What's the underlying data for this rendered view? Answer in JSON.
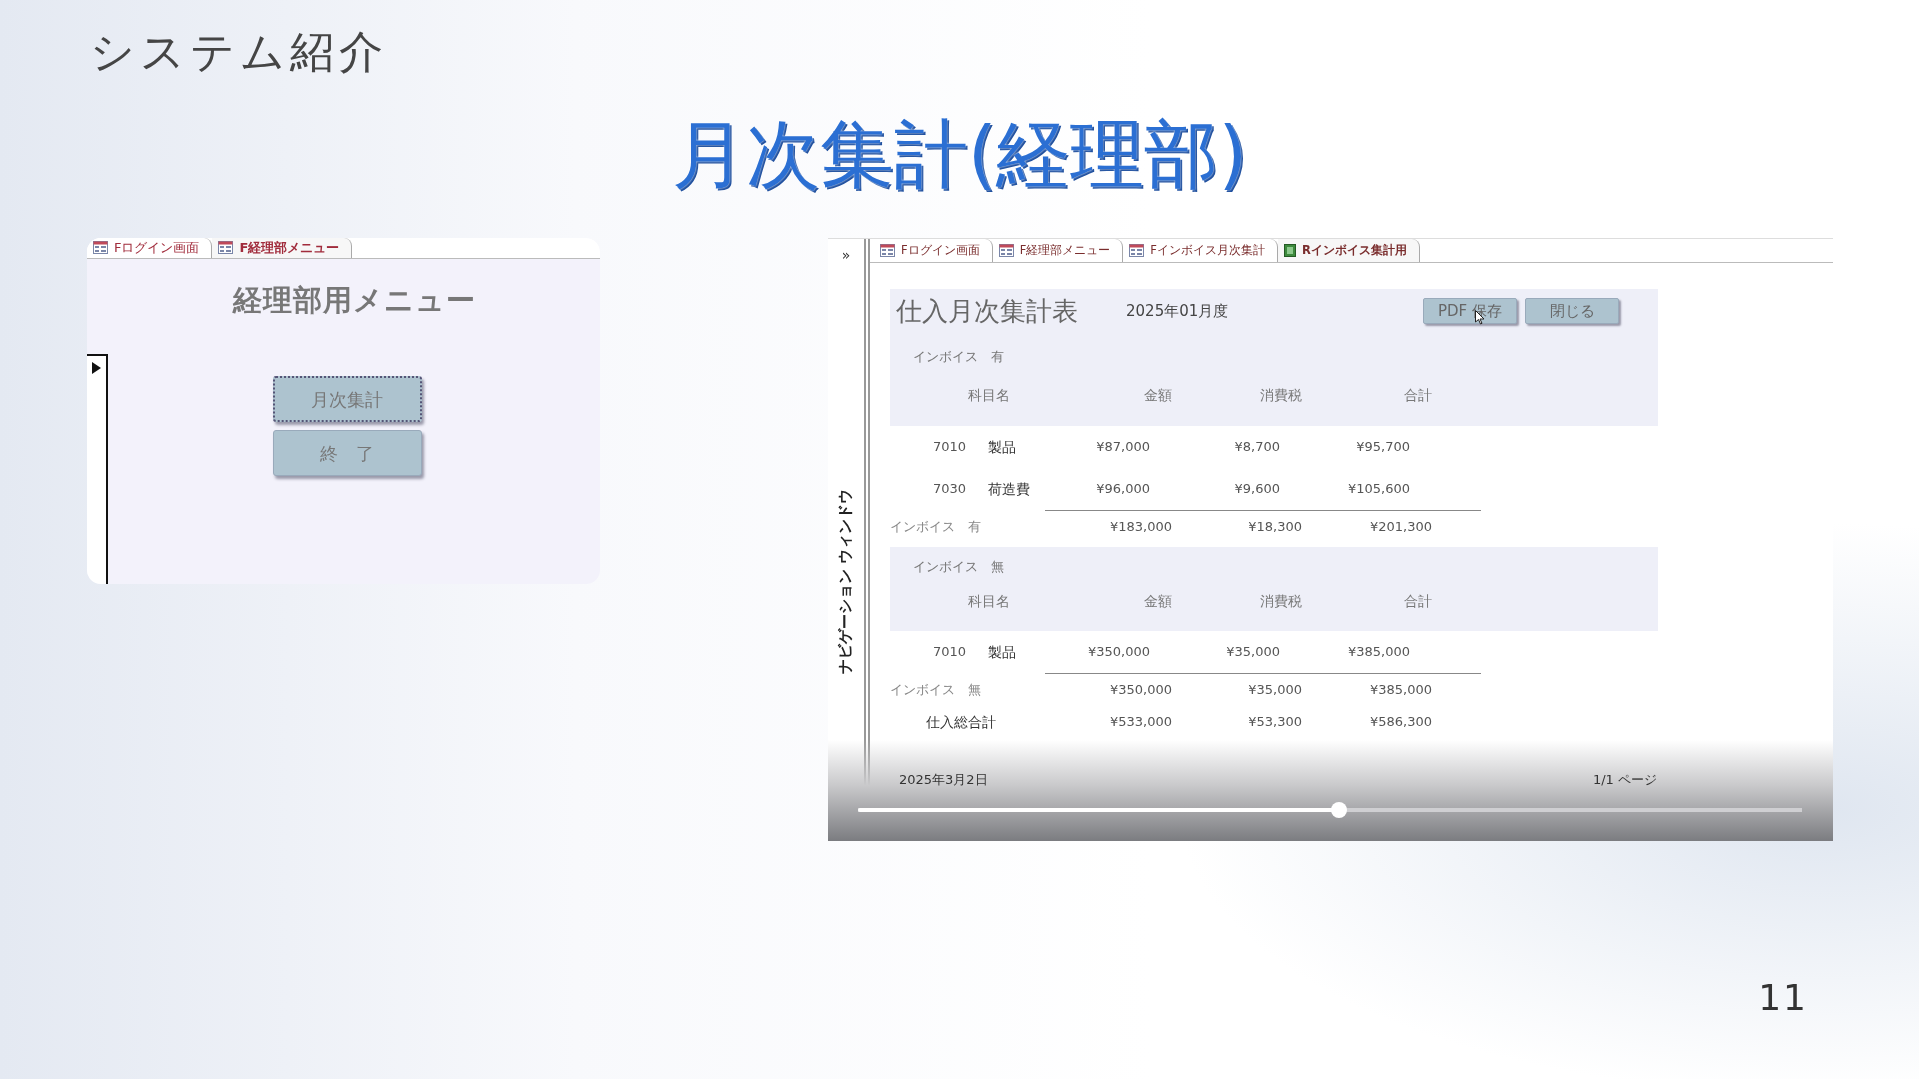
{
  "slide_title": "システム紹介",
  "heading": "月次集計(経理部)",
  "menu_window": {
    "tabs": [
      {
        "label": "Fログイン画面",
        "kind": "form",
        "selected": false
      },
      {
        "label": "F経理部メニュー",
        "kind": "form",
        "selected": true
      }
    ],
    "title": "経理部用メニュー",
    "buttons": [
      {
        "label": "月次集計",
        "focused": true
      },
      {
        "label": "終　了",
        "focused": false
      }
    ]
  },
  "report_window": {
    "nav_toggle": "»",
    "nav_label": "ナビゲーション ウィンドウ",
    "tabs": [
      {
        "label": "Fログイン画面",
        "kind": "form",
        "selected": false
      },
      {
        "label": "F経理部メニュー",
        "kind": "form",
        "selected": false
      },
      {
        "label": "Fインボイス月次集計",
        "kind": "form",
        "selected": false
      },
      {
        "label": "Rインボイス集計用",
        "kind": "report",
        "selected": true
      }
    ],
    "report": {
      "title": "仕入月次集計表",
      "period": "2025年01月度",
      "buttons": [
        "PDF 保存",
        "閉じる"
      ],
      "groups": [
        {
          "label": "インボイス　有",
          "columns": [
            "科目名",
            "金額",
            "消費税",
            "合計"
          ],
          "rows": [
            {
              "code": "7010",
              "name": "製品",
              "amount": "¥87,000",
              "tax": "¥8,700",
              "total": "¥95,700"
            },
            {
              "code": "7030",
              "name": "荷造費",
              "amount": "¥96,000",
              "tax": "¥9,600",
              "total": "¥105,600"
            }
          ],
          "subtotal": {
            "label": "インボイス　有",
            "amount": "¥183,000",
            "tax": "¥18,300",
            "total": "¥201,300"
          }
        },
        {
          "label": "インボイス　無",
          "columns": [
            "科目名",
            "金額",
            "消費税",
            "合計"
          ],
          "rows": [
            {
              "code": "7010",
              "name": "製品",
              "amount": "¥350,000",
              "tax": "¥35,000",
              "total": "¥385,000"
            }
          ],
          "subtotal": {
            "label": "インボイス　無",
            "amount": "¥350,000",
            "tax": "¥35,000",
            "total": "¥385,000"
          }
        }
      ],
      "grand_total": {
        "label": "仕入総合計",
        "amount": "¥533,000",
        "tax": "¥53,300",
        "total": "¥586,300"
      },
      "footer_date": "2025年3月2日",
      "page": "1/1 ページ"
    },
    "playback": {
      "level": 0.51
    }
  },
  "page_number": "11"
}
